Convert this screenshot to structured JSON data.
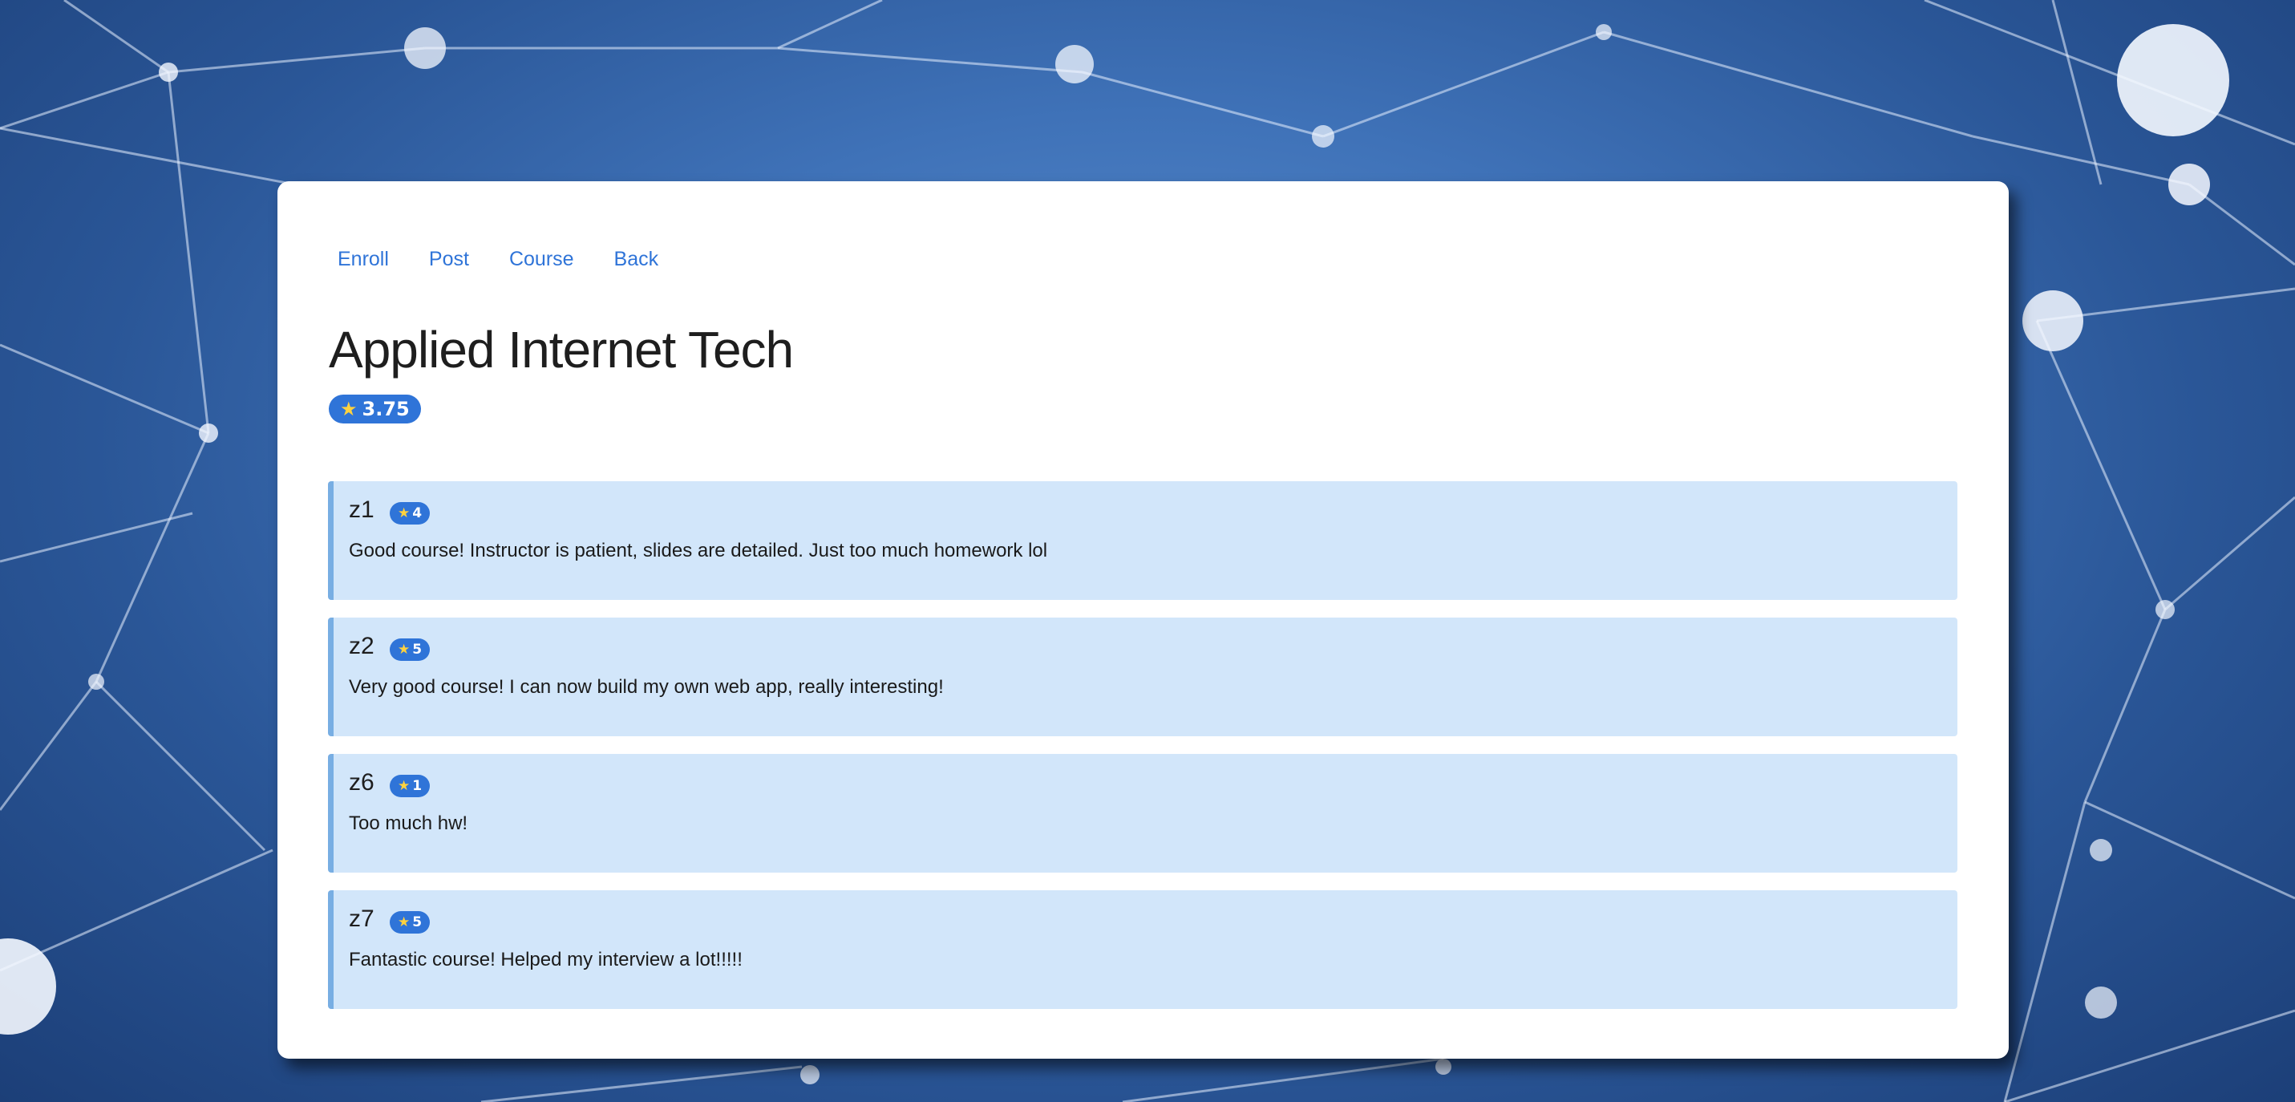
{
  "nav": {
    "items": [
      "Enroll",
      "Post",
      "Course",
      "Back"
    ]
  },
  "course": {
    "title": "Applied Internet Tech",
    "rating": "3.75",
    "rating_icon": "star-icon"
  },
  "reviews": [
    {
      "user": "z1",
      "rating": "4",
      "text": "Good course! Instructor is patient, slides are detailed. Just too much homework lol"
    },
    {
      "user": "z2",
      "rating": "5",
      "text": "Very good course! I can now build my own web app, really interesting!"
    },
    {
      "user": "z6",
      "rating": "1",
      "text": "Too much hw!"
    },
    {
      "user": "z7",
      "rating": "5",
      "text": "Fantastic course! Helped my interview a lot!!!!!"
    }
  ],
  "colors": {
    "accent": "#2f74d8",
    "review_bg": "#d2e6fa",
    "review_border": "#78aee3",
    "star": "#ffd23f"
  }
}
